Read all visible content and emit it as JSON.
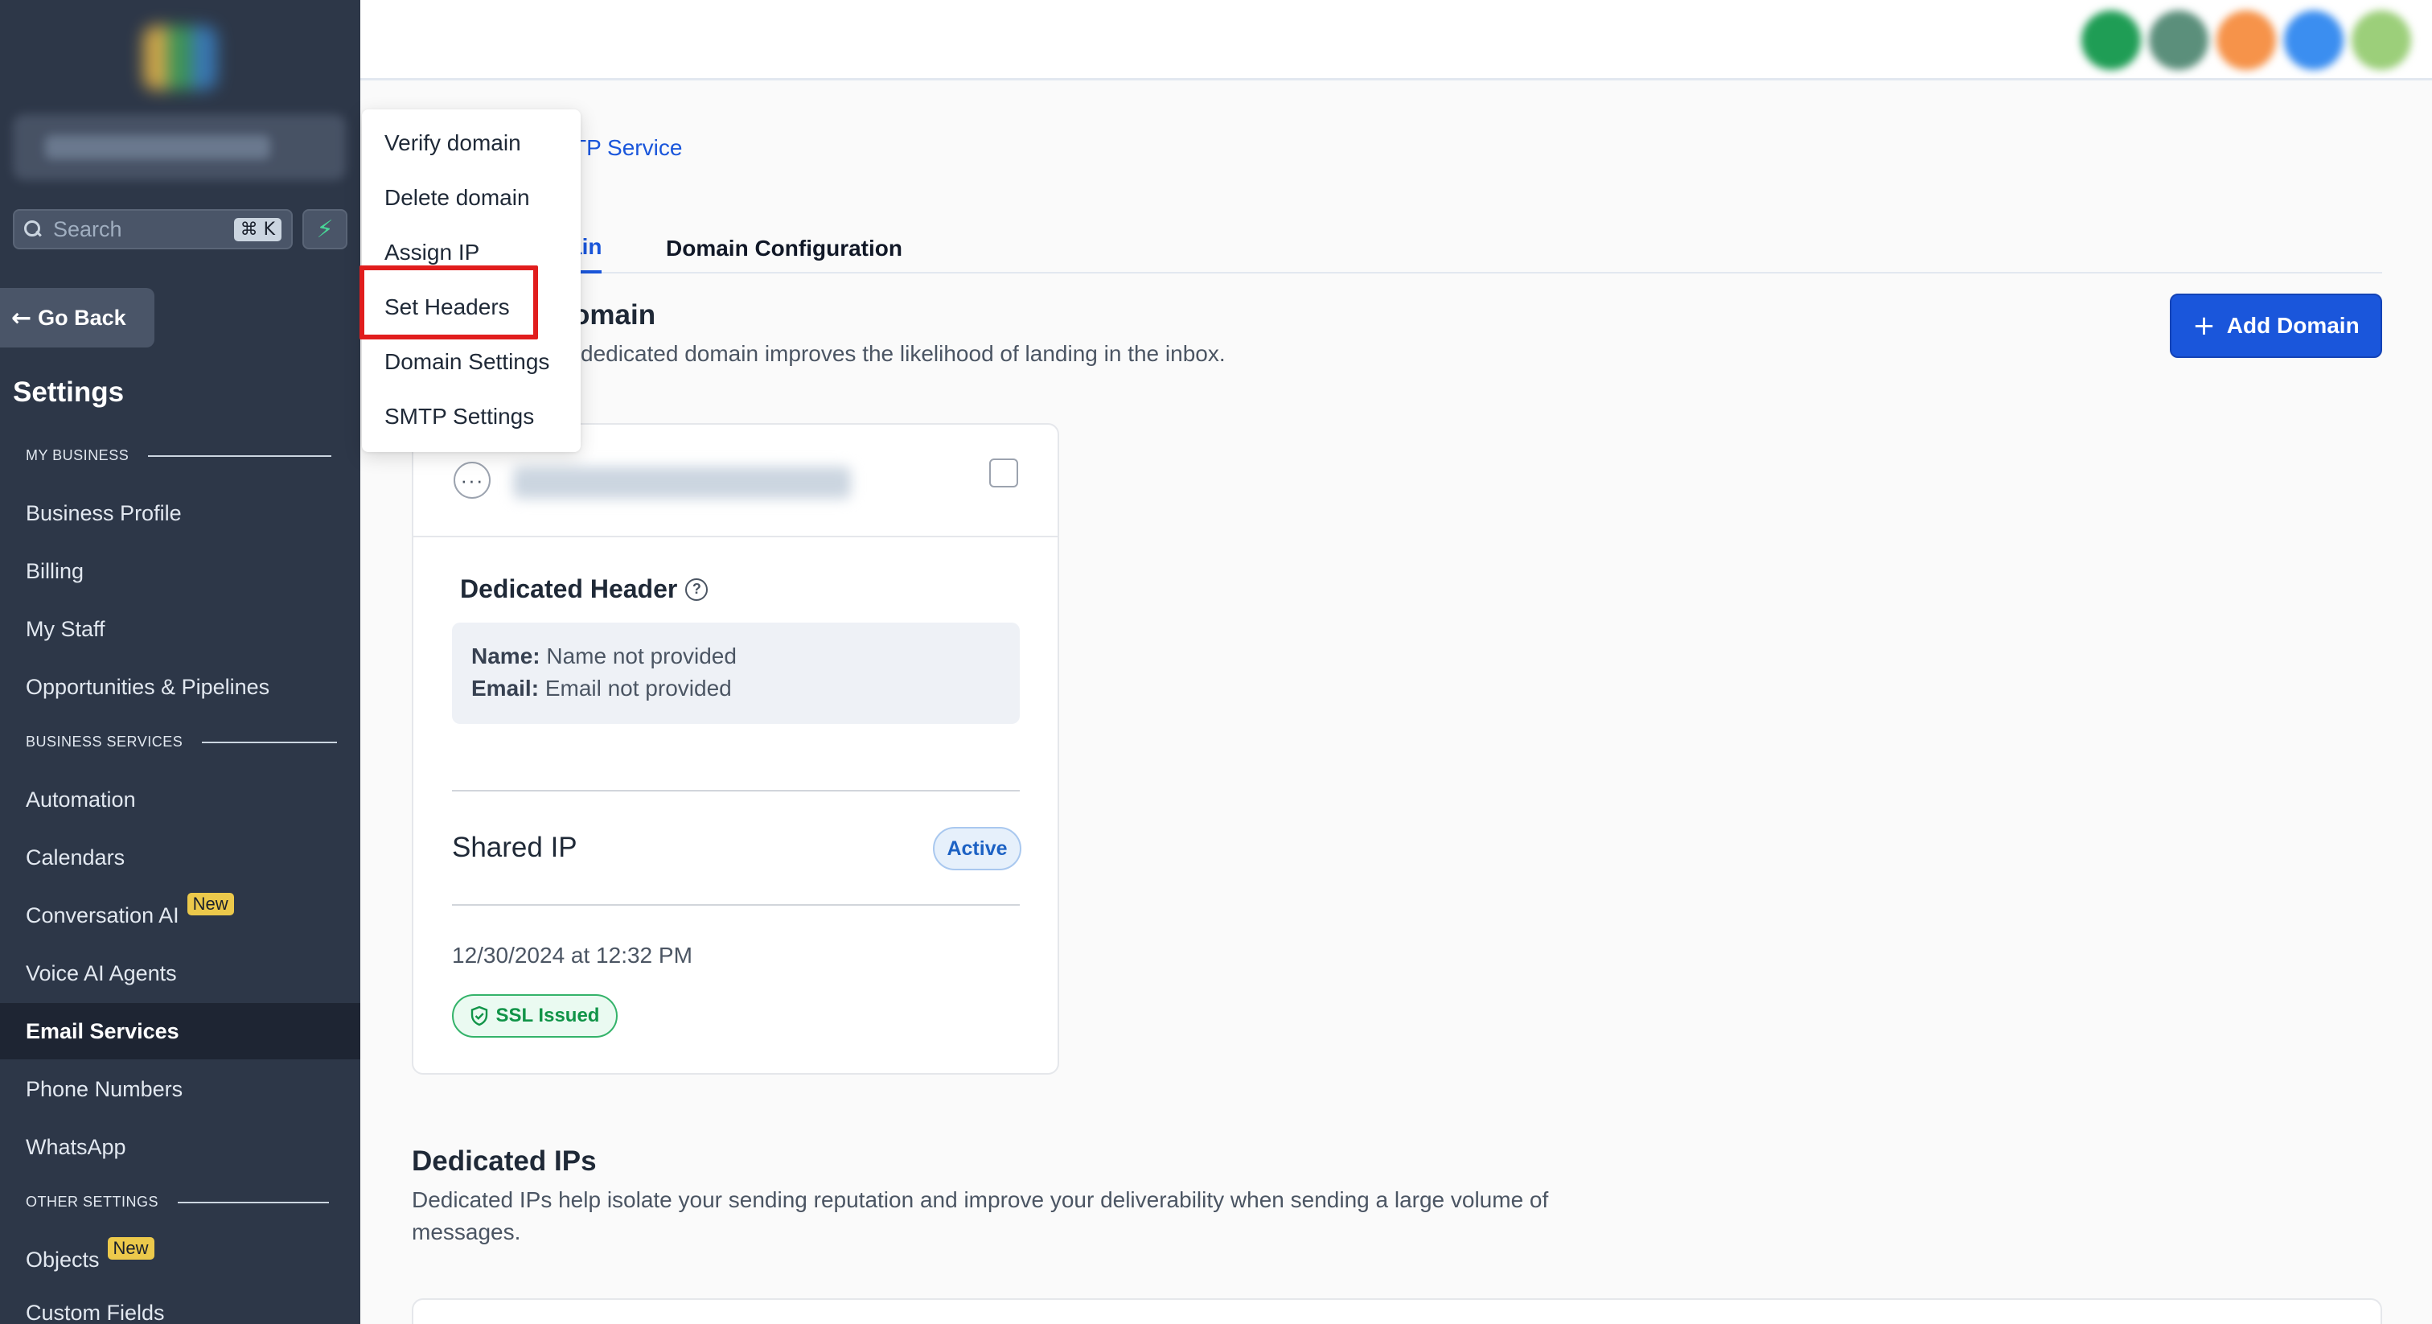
{
  "sidebar": {
    "search_placeholder": "Search",
    "search_shortcut": "⌘ K",
    "go_back_label": "Go Back",
    "settings_title": "Settings",
    "sections": [
      {
        "header": "MY BUSINESS"
      },
      {
        "header": "BUSINESS SERVICES"
      },
      {
        "header": "OTHER SETTINGS"
      }
    ],
    "items": [
      {
        "label": "Business Profile"
      },
      {
        "label": "Billing"
      },
      {
        "label": "My Staff"
      },
      {
        "label": "Opportunities & Pipelines"
      },
      {
        "label": "Automation"
      },
      {
        "label": "Calendars"
      },
      {
        "label": "Conversation AI",
        "badge": "New"
      },
      {
        "label": "Voice AI Agents"
      },
      {
        "label": "Email Services",
        "active": true
      },
      {
        "label": "Phone Numbers"
      },
      {
        "label": "WhatsApp"
      },
      {
        "label": "Objects",
        "badge": "New"
      },
      {
        "label": "Custom Fields"
      }
    ]
  },
  "main": {
    "breadcrumb": "TP Service",
    "tabs": [
      {
        "label": "ain",
        "active": true
      },
      {
        "label": "Domain Configuration",
        "active": false
      }
    ],
    "domain_section": {
      "title": "omain",
      "subtitle": "dedicated domain improves the likelihood of landing in the inbox.",
      "add_button": "Add Domain"
    },
    "domain_card": {
      "more_label": "···",
      "dedicated_header_title": "Dedicated Header",
      "help_glyph": "?",
      "name_label": "Name:",
      "name_value": "Name not provided",
      "email_label": "Email:",
      "email_value": "Email not provided",
      "shared_ip_label": "Shared IP",
      "status_badge": "Active",
      "date": "12/30/2024 at 12:32 PM",
      "ssl_badge": "SSL Issued"
    },
    "dedicated_ips": {
      "title": "Dedicated IPs",
      "subtitle_line1": "Dedicated IPs help isolate your sending reputation and improve your deliverability when sending a large volume of",
      "subtitle_line2": "messages."
    }
  },
  "context_menu": {
    "items": [
      {
        "label": "Verify domain"
      },
      {
        "label": "Delete domain"
      },
      {
        "label": "Assign IP"
      },
      {
        "label": "Set Headers",
        "highlighted": true
      },
      {
        "label": "Domain Settings"
      },
      {
        "label": "SMTP Settings"
      }
    ]
  },
  "colors": {
    "sidebar_bg": "#2d3748",
    "accent": "#1a56db",
    "highlight": "#e11d1d",
    "success": "#119448",
    "new_badge": "#ecc94b"
  }
}
